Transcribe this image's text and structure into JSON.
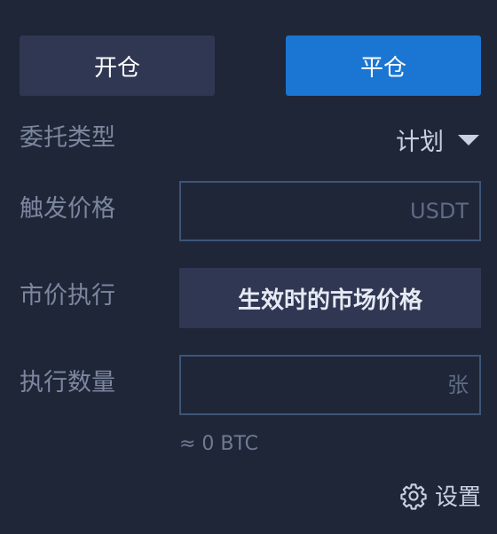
{
  "actions": {
    "open_label": "开仓",
    "close_label": "平仓"
  },
  "order_type": {
    "label": "委托类型",
    "value": "计划"
  },
  "trigger_price": {
    "label": "触发价格",
    "placeholder": "USDT",
    "value": ""
  },
  "market_execution": {
    "label": "市价执行",
    "value": "生效时的市场价格"
  },
  "quantity": {
    "label": "执行数量",
    "placeholder": "张",
    "value": "",
    "approx": "≈ 0 BTC"
  },
  "settings": {
    "label": "设置",
    "icon": "gear-icon"
  },
  "colors": {
    "background": "#1f2638",
    "accent": "#1a76d2",
    "panel": "#2f3753",
    "input_border": "#3d5578"
  }
}
